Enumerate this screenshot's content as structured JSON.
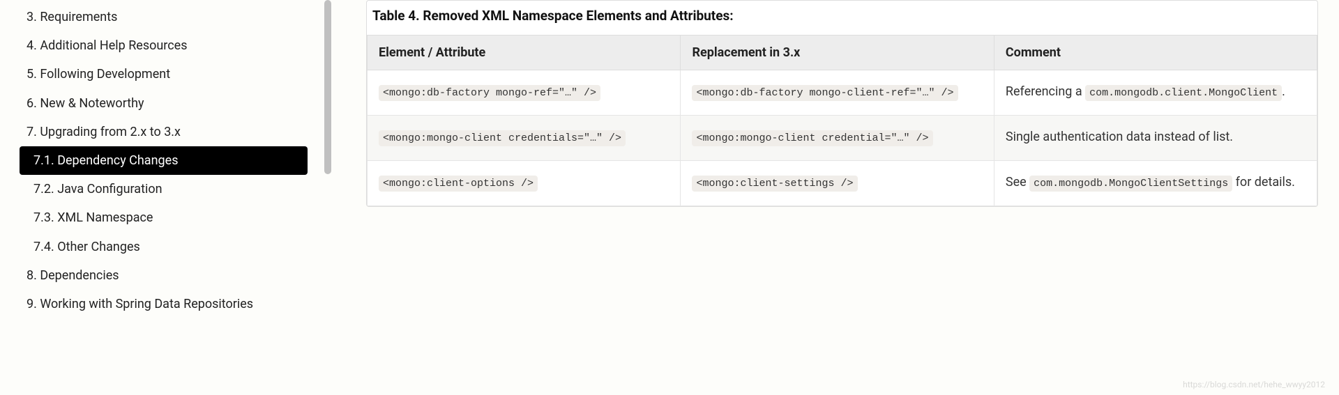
{
  "sidebar": {
    "items": [
      {
        "label": "3. Requirements",
        "sub": false,
        "active": false
      },
      {
        "label": "4. Additional Help Resources",
        "sub": false,
        "active": false
      },
      {
        "label": "5. Following Development",
        "sub": false,
        "active": false
      },
      {
        "label": "6. New & Noteworthy",
        "sub": false,
        "active": false
      },
      {
        "label": "7. Upgrading from 2.x to 3.x",
        "sub": false,
        "active": false
      },
      {
        "label": "7.1. Dependency Changes",
        "sub": true,
        "active": true
      },
      {
        "label": "7.2. Java Configuration",
        "sub": true,
        "active": false
      },
      {
        "label": "7.3. XML Namespace",
        "sub": true,
        "active": false
      },
      {
        "label": "7.4. Other Changes",
        "sub": true,
        "active": false
      },
      {
        "label": "8. Dependencies",
        "sub": false,
        "active": false
      },
      {
        "label": "9. Working with Spring Data Repositories",
        "sub": false,
        "active": false
      }
    ]
  },
  "table": {
    "caption": "Table 4. Removed XML Namespace Elements and Attributes:",
    "headers": [
      "Element / Attribute",
      "Replacement in 3.x",
      "Comment"
    ],
    "rows": [
      {
        "col1_code": "<mongo:db-factory mongo-ref=\"…\" />",
        "col2_code": "<mongo:db-factory mongo-client-ref=\"…\" />",
        "col3_pre": "Referencing a ",
        "col3_code": "com.mongodb.client.MongoClient",
        "col3_post": "."
      },
      {
        "col1_code": "<mongo:mongo-client credentials=\"…\" />",
        "col2_code": "<mongo:mongo-client credential=\"…\" />",
        "col3_pre": "Single authentication data instead of list.",
        "col3_code": "",
        "col3_post": ""
      },
      {
        "col1_code": "<mongo:client-options />",
        "col2_code": "<mongo:client-settings />",
        "col3_pre": "See ",
        "col3_code": "com.mongodb.MongoClientSettings",
        "col3_post": " for details."
      }
    ]
  },
  "watermark": "https://blog.csdn.net/hehe_wwyy2012"
}
